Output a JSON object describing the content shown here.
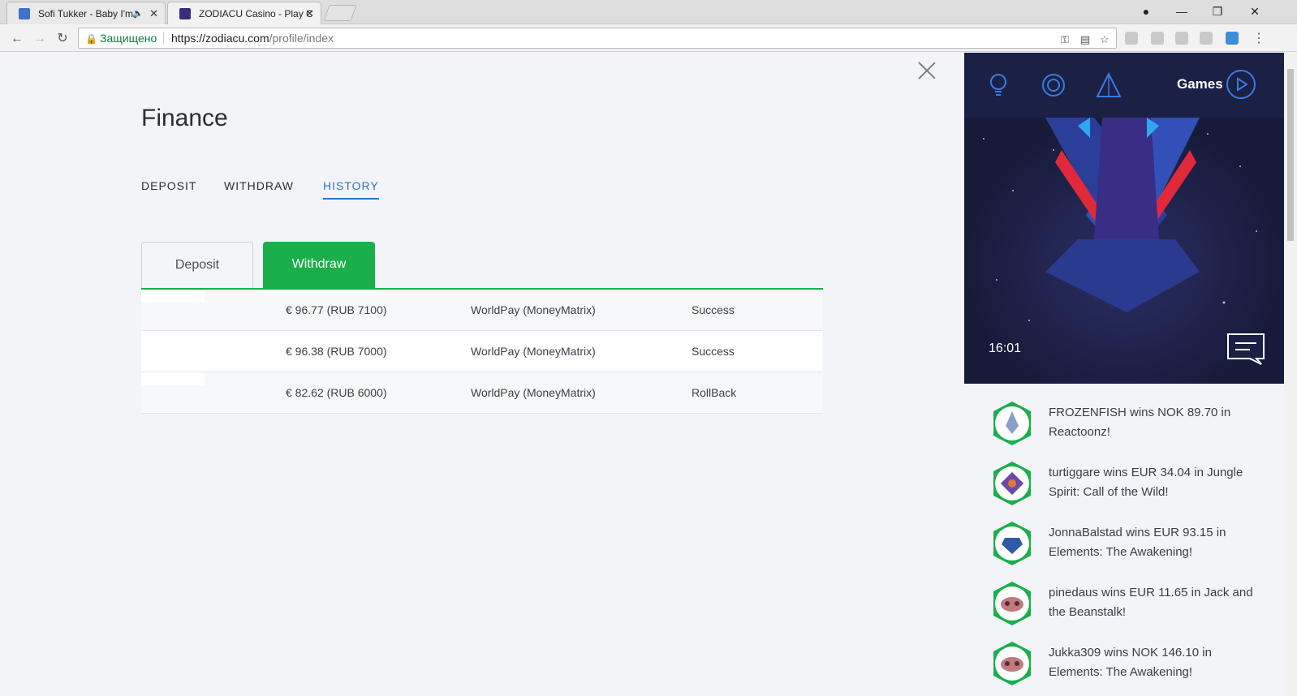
{
  "browser": {
    "tabs": [
      {
        "title": "Sofi Tukker - Baby I'm"
      },
      {
        "title": "ZODIACU Casino - Play C"
      }
    ],
    "secure_label": "Защищено",
    "url_host": "https://zodiacu.com",
    "url_path": "/profile/index"
  },
  "page": {
    "title": "Finance",
    "nav_tabs": [
      "DEPOSIT",
      "WITHDRAW",
      "HISTORY"
    ],
    "active_nav": "HISTORY",
    "subtabs": {
      "deposit": "Deposit",
      "withdraw": "Withdraw"
    },
    "table": {
      "rows": [
        {
          "amount": "€ 96.77 (RUB 7100)",
          "method": "WorldPay (MoneyMatrix)",
          "status": "Success"
        },
        {
          "amount": "€ 96.38 (RUB 7000)",
          "method": "WorldPay (MoneyMatrix)",
          "status": "Success"
        },
        {
          "amount": "€ 82.62 (RUB 6000)",
          "method": "WorldPay (MoneyMatrix)",
          "status": "RollBack"
        }
      ]
    }
  },
  "side": {
    "games_label": "Games",
    "time": "16:01",
    "feed": [
      "FROZENFISH wins NOK 89.70 in Reactoonz!",
      "turtiggare wins EUR 34.04 in Jungle Spirit: Call of the Wild!",
      "JonnaBalstad wins EUR 93.15 in Elements: The Awakening!",
      "pinedaus wins EUR 11.65 in Jack and the Beanstalk!",
      "Jukka309 wins NOK 146.10 in Elements: The Awakening!"
    ]
  },
  "colors": {
    "accent_green": "#1aaf4b",
    "accent_blue": "#2d74c8",
    "panel_dark": "#1a1f44"
  }
}
